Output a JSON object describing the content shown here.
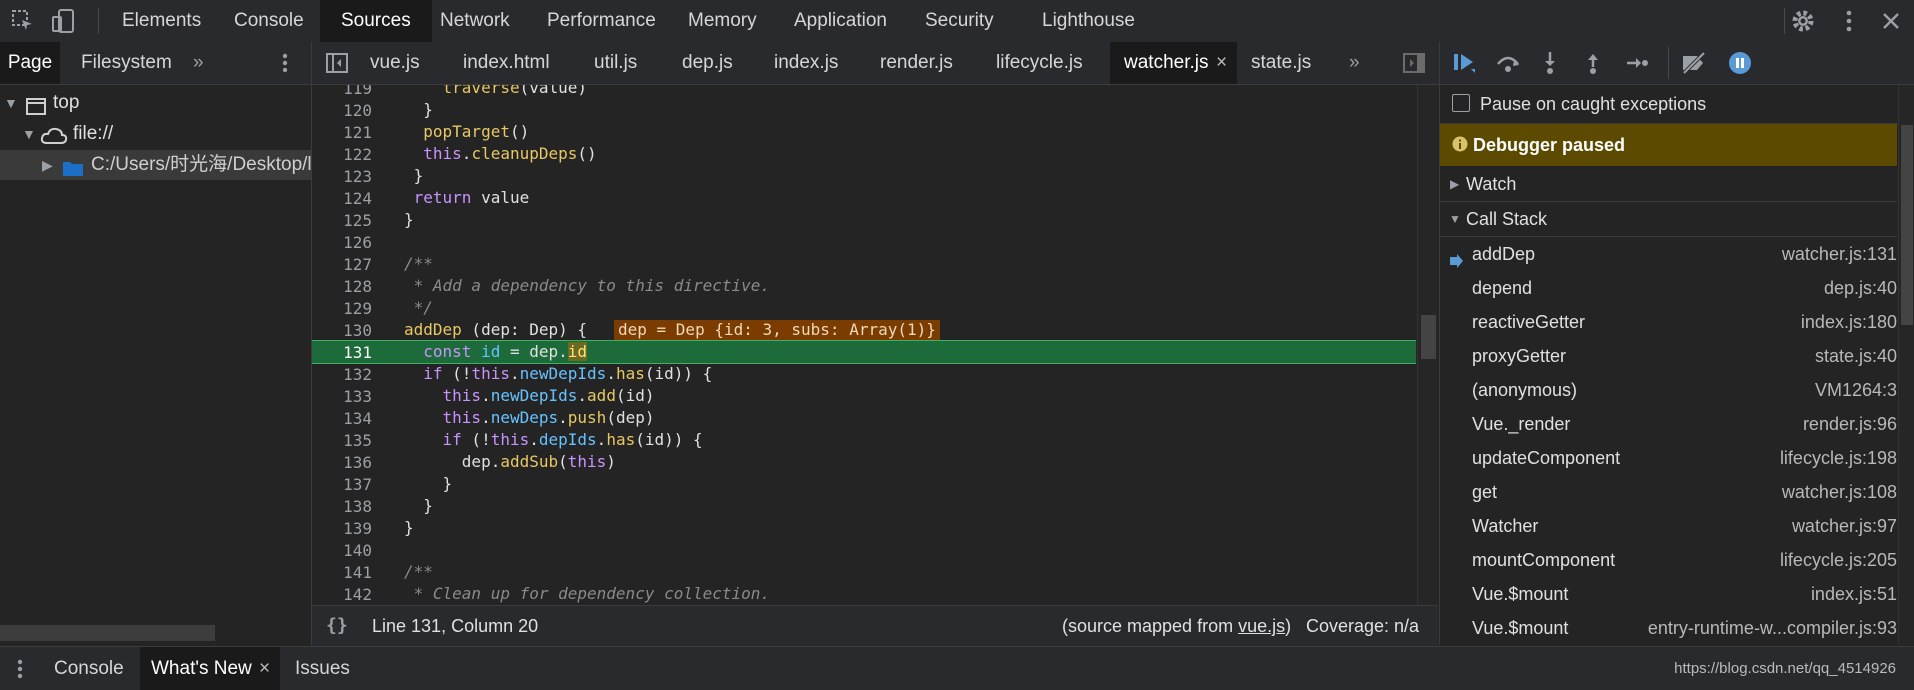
{
  "top_tabs": [
    "Elements",
    "Console",
    "Sources",
    "Network",
    "Performance",
    "Memory",
    "Application",
    "Security",
    "Lighthouse"
  ],
  "active_top_tab": "Sources",
  "navigator": {
    "tabs": [
      "Page",
      "Filesystem"
    ],
    "active": "Page",
    "tree": {
      "top": "top",
      "file": "file://",
      "folder": "C:/Users/时光海/Desktop/l"
    }
  },
  "file_tabs": [
    "vue.js",
    "index.html",
    "util.js",
    "dep.js",
    "index.js",
    "render.js",
    "lifecycle.js",
    "watcher.js",
    "state.js"
  ],
  "active_file": "watcher.js",
  "code": {
    "line_numbers": [
      "119",
      "120",
      "121",
      "122",
      "123",
      "124",
      "125",
      "126",
      "127",
      "128",
      "129",
      "130",
      "131",
      "132",
      "133",
      "134",
      "135",
      "136",
      "137",
      "138",
      "139",
      "140",
      "141",
      "142"
    ],
    "inline_value": "dep = Dep {id: 3, subs: Array(1)}"
  },
  "status": {
    "position": "Line 131, Column 20",
    "source_mapped_prefix": "(source mapped from ",
    "source_mapped_link": "vue.js",
    "source_mapped_suffix": ")",
    "coverage": "Coverage: n/a"
  },
  "debugger": {
    "pause_on_caught": "Pause on caught exceptions",
    "paused_banner": "Debugger paused",
    "watch_label": "Watch",
    "call_stack_label": "Call Stack",
    "call_stack": [
      {
        "fn": "addDep",
        "loc": "watcher.js:131"
      },
      {
        "fn": "depend",
        "loc": "dep.js:40"
      },
      {
        "fn": "reactiveGetter",
        "loc": "index.js:180"
      },
      {
        "fn": "proxyGetter",
        "loc": "state.js:40"
      },
      {
        "fn": "(anonymous)",
        "loc": "VM1264:3"
      },
      {
        "fn": "Vue._render",
        "loc": "render.js:96"
      },
      {
        "fn": "updateComponent",
        "loc": "lifecycle.js:198"
      },
      {
        "fn": "get",
        "loc": "watcher.js:108"
      },
      {
        "fn": "Watcher",
        "loc": "watcher.js:97"
      },
      {
        "fn": "mountComponent",
        "loc": "lifecycle.js:205"
      },
      {
        "fn": "Vue.$mount",
        "loc": "index.js:51"
      },
      {
        "fn": "Vue.$mount",
        "loc": "entry-runtime-w...compiler.js:93"
      }
    ]
  },
  "drawer": {
    "tabs": [
      "Console",
      "What's New",
      "Issues"
    ],
    "active": "What's New",
    "url": "https://blog.csdn.net/qq_4514926"
  },
  "colors": {
    "paused_banner_bg": "#5c4a00",
    "execution_line_bg": "#1d6b3a",
    "inline_value_bg": "#7a3c00",
    "accent": "#5b9bd5"
  }
}
